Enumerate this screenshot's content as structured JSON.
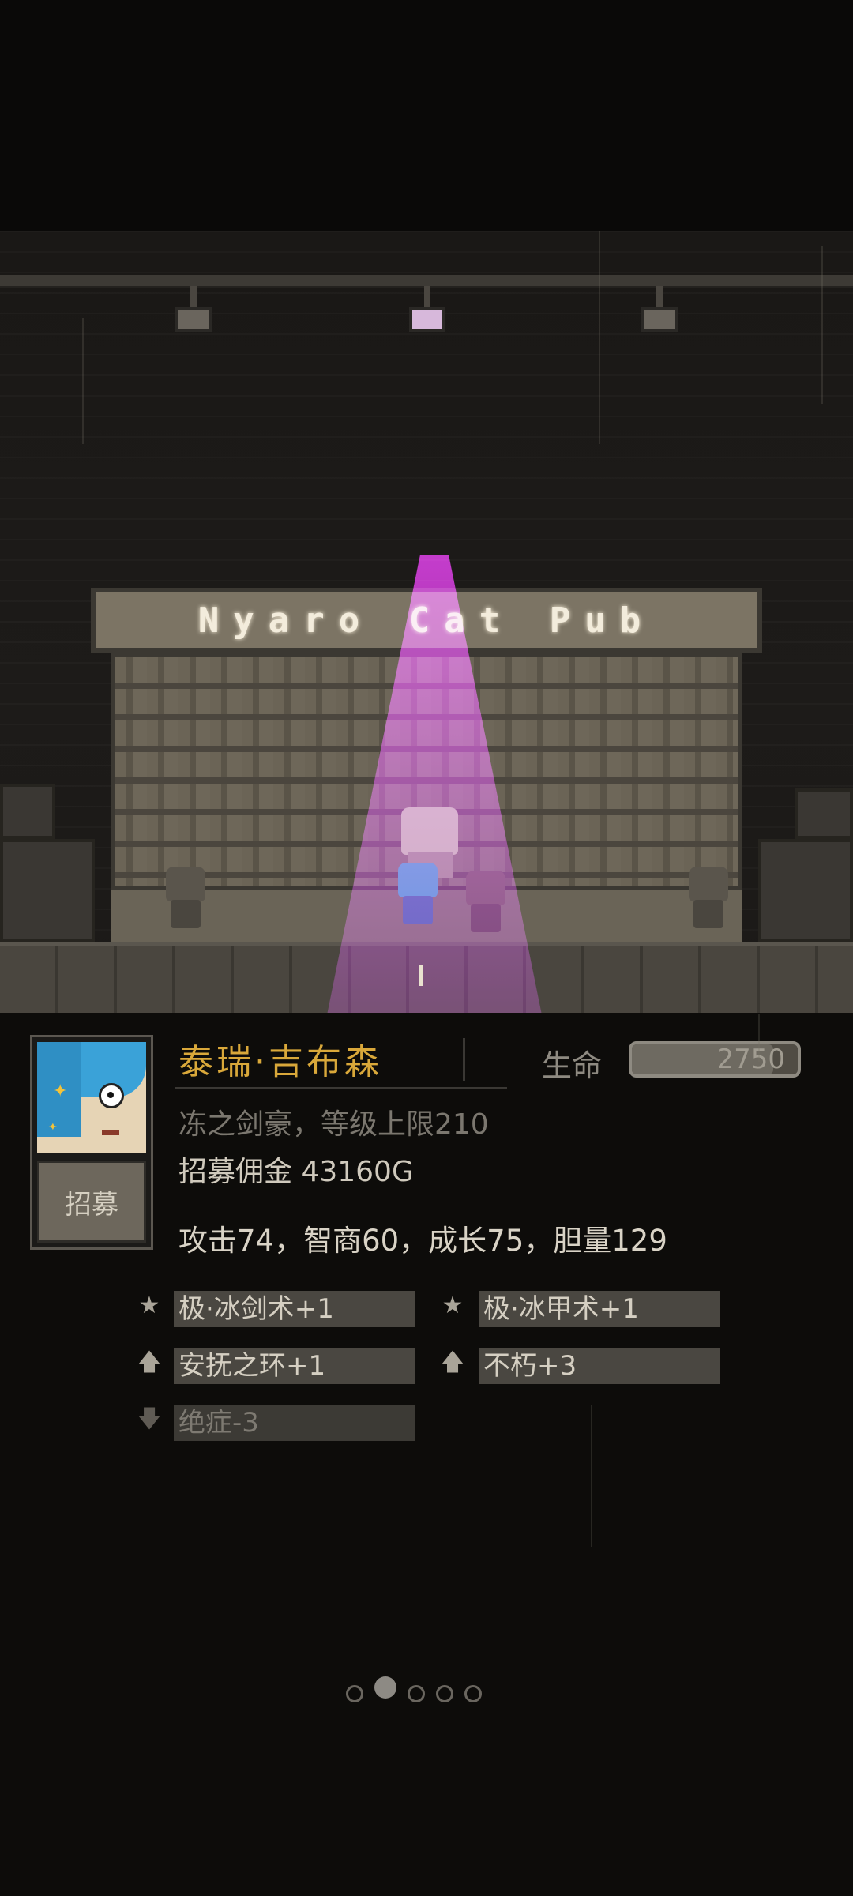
{
  "pub_sign": "Nyaro Cat Pub",
  "hero": {
    "name": "泰瑞·吉布森",
    "hp_label": "生命",
    "hp_value": "2750",
    "hp_fill_fraction": 0.85,
    "title_line": "冻之剑豪，等级上限210",
    "fee_line": "招募佣金 43160G",
    "stats_line": "攻击74，智商60，成长75，胆量129",
    "recruit_label": "招募"
  },
  "skills": [
    {
      "icon": "star-icon",
      "symbol": "★",
      "label": "极·冰剑术+1",
      "positive": true
    },
    {
      "icon": "star-icon",
      "symbol": "★",
      "label": "极·冰甲术+1",
      "positive": true
    },
    {
      "icon": "arrow-up-icon",
      "symbol": "🡅",
      "label": "安抚之环+1",
      "positive": true
    },
    {
      "icon": "arrow-up-icon",
      "symbol": "🡅",
      "label": "不朽+3",
      "positive": true
    },
    {
      "icon": "arrow-down-icon",
      "symbol": "🡇",
      "label": "绝症-3",
      "positive": false
    }
  ],
  "pagination": {
    "total": 5,
    "active_index": 1
  },
  "colors": {
    "name_gold": "#d9a83a",
    "spotlight_purple": "#c828d2",
    "portrait_hair": "#3aa2d8"
  }
}
